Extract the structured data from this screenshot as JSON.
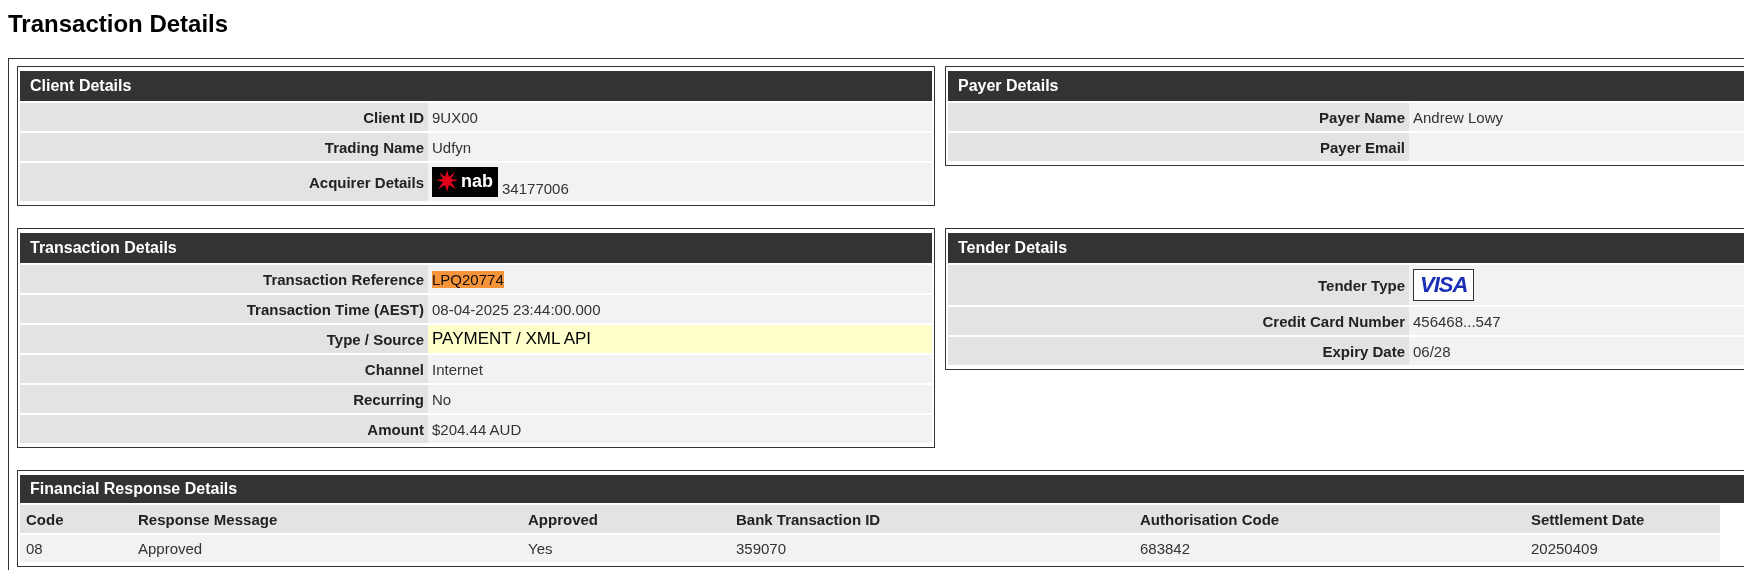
{
  "title": "Transaction Details",
  "panel_rows": [
    [
      {
        "title": "Client Details",
        "rows": [
          {
            "label": "Client ID",
            "kind": "text",
            "value": "9UX00"
          },
          {
            "label": "Trading Name",
            "kind": "text",
            "value": "Udfyn"
          },
          {
            "label": "Acquirer Details",
            "kind": "bank-logo",
            "logo_text": "nab",
            "value": "34177006"
          }
        ]
      },
      {
        "title": "Payer Details",
        "rows": [
          {
            "label": "Payer Name",
            "kind": "text",
            "value": "Andrew Lowy"
          },
          {
            "label": "Payer Email",
            "kind": "text"
          }
        ]
      }
    ],
    [
      {
        "title": "Transaction Details",
        "rows": [
          {
            "label": "Transaction Reference",
            "kind": "reference",
            "value": "LPQ20774"
          },
          {
            "label": "Transaction Time (AEST)",
            "kind": "text",
            "value": "08-04-2025 23:44:00.000"
          },
          {
            "label": "Type / Source",
            "kind": "emphasis",
            "value": "PAYMENT / XML API"
          },
          {
            "label": "Channel",
            "kind": "text",
            "value": "Internet"
          },
          {
            "label": "Recurring",
            "kind": "text",
            "value": "No"
          },
          {
            "label": "Amount",
            "kind": "text",
            "value": "$204.44 AUD"
          }
        ]
      },
      {
        "title": "Tender Details",
        "rows": [
          {
            "label": "Tender Type",
            "kind": "card-logo",
            "logo_text": "VISA"
          },
          {
            "label": "Credit Card Number",
            "kind": "text",
            "value": "456468...547"
          },
          {
            "label": "Expiry Date",
            "kind": "text",
            "value": "06/28"
          }
        ]
      }
    ]
  ],
  "financial_response": {
    "title": "Financial Response Details",
    "columns": [
      "Code",
      "Response Message",
      "Approved",
      "Bank Transaction ID",
      "Authorisation Code",
      "Settlement Date"
    ],
    "rows": [
      [
        "08",
        "Approved",
        "Yes",
        "359070",
        "683842",
        "20250409"
      ]
    ]
  }
}
